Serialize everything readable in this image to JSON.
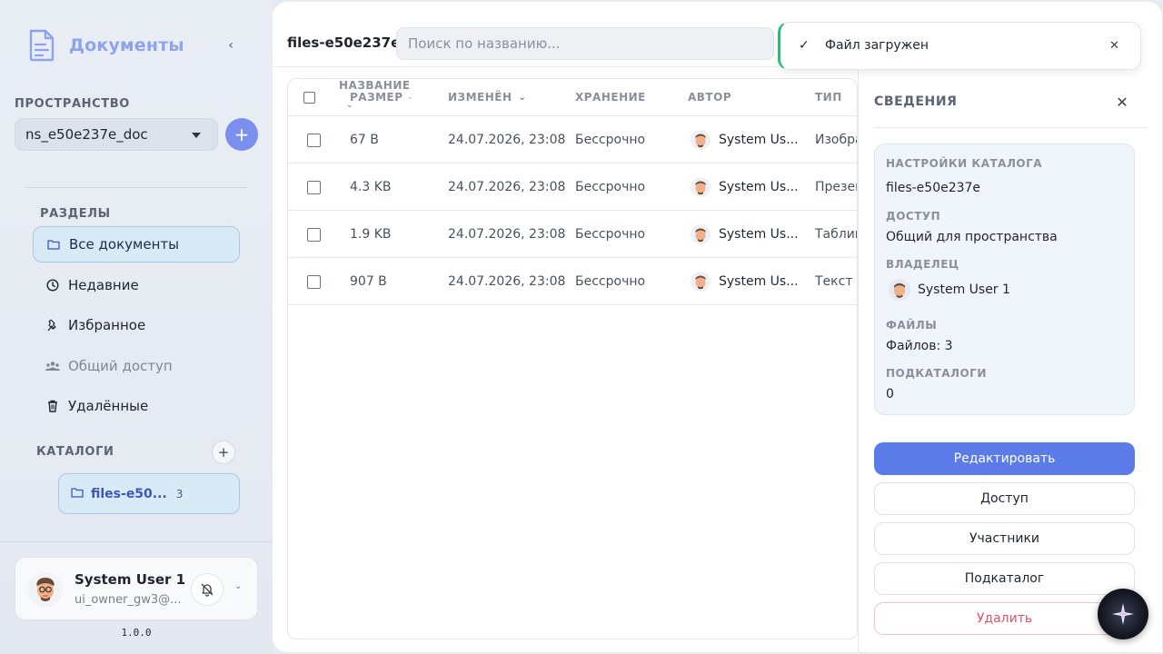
{
  "sidebar": {
    "brand": "Документы",
    "space_label": "ПРОСТРАНСТВО",
    "namespace": "ns_e50e237e_doc",
    "sections_label": "РАЗДЕЛЫ",
    "nav": [
      {
        "label": "Все документы",
        "icon": "folder-icon"
      },
      {
        "label": "Недавние",
        "icon": "clock-icon"
      },
      {
        "label": "Избранное",
        "icon": "pin-icon"
      },
      {
        "label": "Общий доступ",
        "icon": "users-icon"
      },
      {
        "label": "Удалённые",
        "icon": "trash-icon"
      }
    ],
    "catalogs_label": "КАТАЛОГИ",
    "catalog": {
      "name": "files-e50...",
      "count": "3"
    },
    "user": {
      "name": "System User 1",
      "email": "ui_owner_gw3@..."
    },
    "version": "1.0.0"
  },
  "header": {
    "crumb": "files-e50e237e",
    "search_placeholder": "Поиск по названию..."
  },
  "table": {
    "headers": {
      "name": "НАЗВАНИЕ",
      "size": "РАЗМЕР",
      "modified": "ИЗМЕНЁН",
      "storage": "ХРАНЕНИЕ",
      "author": "АВТОР",
      "type": "ТИП"
    },
    "rows": [
      {
        "size": "67 B",
        "modified": "24.07.2026, 23:08",
        "storage": "Бессрочно",
        "author": "System Us...",
        "type": "Изобра"
      },
      {
        "size": "4.3 KB",
        "modified": "24.07.2026, 23:08",
        "storage": "Бессрочно",
        "author": "System Us...",
        "type": "Презен"
      },
      {
        "size": "1.9 KB",
        "modified": "24.07.2026, 23:08",
        "storage": "Бессрочно",
        "author": "System Us...",
        "type": "Таблиц"
      },
      {
        "size": "907 B",
        "modified": "24.07.2026, 23:08",
        "storage": "Бессрочно",
        "author": "System Us...",
        "type": "Текст"
      }
    ]
  },
  "details": {
    "title": "СВЕДЕНИЯ",
    "catalog_settings_label": "НАСТРОЙКИ КАТАЛОГА",
    "catalog_settings_value": "files-e50e237e",
    "access_label": "ДОСТУП",
    "access_value": "Общий для пространства",
    "owner_label": "ВЛАДЕЛЕЦ",
    "owner_value": "System User 1",
    "files_label": "ФАЙЛЫ",
    "files_value": "Файлов: 3",
    "subcatalogs_label": "ПОДКАТАЛОГИ",
    "subcatalogs_value": "0",
    "buttons": {
      "edit": "Редактировать",
      "access": "Доступ",
      "members": "Участники",
      "subcatalog": "Подкаталог",
      "delete": "Удалить"
    }
  },
  "toast": {
    "message": "Файл загружен"
  },
  "colors": {
    "accent": "#5b7ce8",
    "brand": "#8ea4ea",
    "success": "#2fba7c",
    "danger": "#e0516b"
  }
}
